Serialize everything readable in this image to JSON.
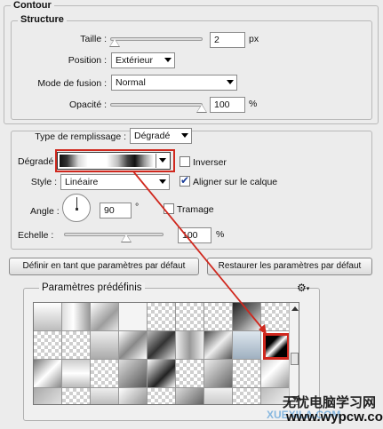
{
  "section_title": "Contour",
  "structure": {
    "title": "Structure",
    "taille": {
      "label": "Taille :",
      "value": "2",
      "unit": "px",
      "level": 0.02
    },
    "position": {
      "label": "Position :",
      "value": "Extérieur"
    },
    "mode": {
      "label": "Mode de fusion :",
      "value": "Normal"
    },
    "opacite": {
      "label": "Opacité :",
      "value": "100",
      "unit": "%",
      "level": 1.0
    }
  },
  "fill": {
    "type": {
      "label": "Type de remplissage :",
      "value": "Dégradé"
    },
    "degrade": {
      "label": "Dégradé :"
    },
    "inverser": {
      "label": "Inverser",
      "checked": false
    },
    "style": {
      "label": "Style :",
      "value": "Linéaire"
    },
    "aligner": {
      "label": "Aligner sur le calque",
      "checked": true
    },
    "angle": {
      "label": "Angle :",
      "value": "90",
      "unit": "°"
    },
    "tramage": {
      "label": "Tramage",
      "checked": false
    },
    "echelle": {
      "label": "Echelle :",
      "value": "100",
      "unit": "%",
      "level": 0.5
    }
  },
  "buttons": {
    "default_set": "Définir en tant que paramètres par défaut",
    "default_reset": "Restaurer les paramètres par défaut"
  },
  "presets": {
    "title": "Paramètres prédéfinis",
    "gear_icon": "gear-icon",
    "highlight_color": "#d0281e"
  },
  "watermark": {
    "cn": "无忧电脑学习网",
    "url": "www.wypcw.com",
    "small": "XUEXILA.COM"
  }
}
